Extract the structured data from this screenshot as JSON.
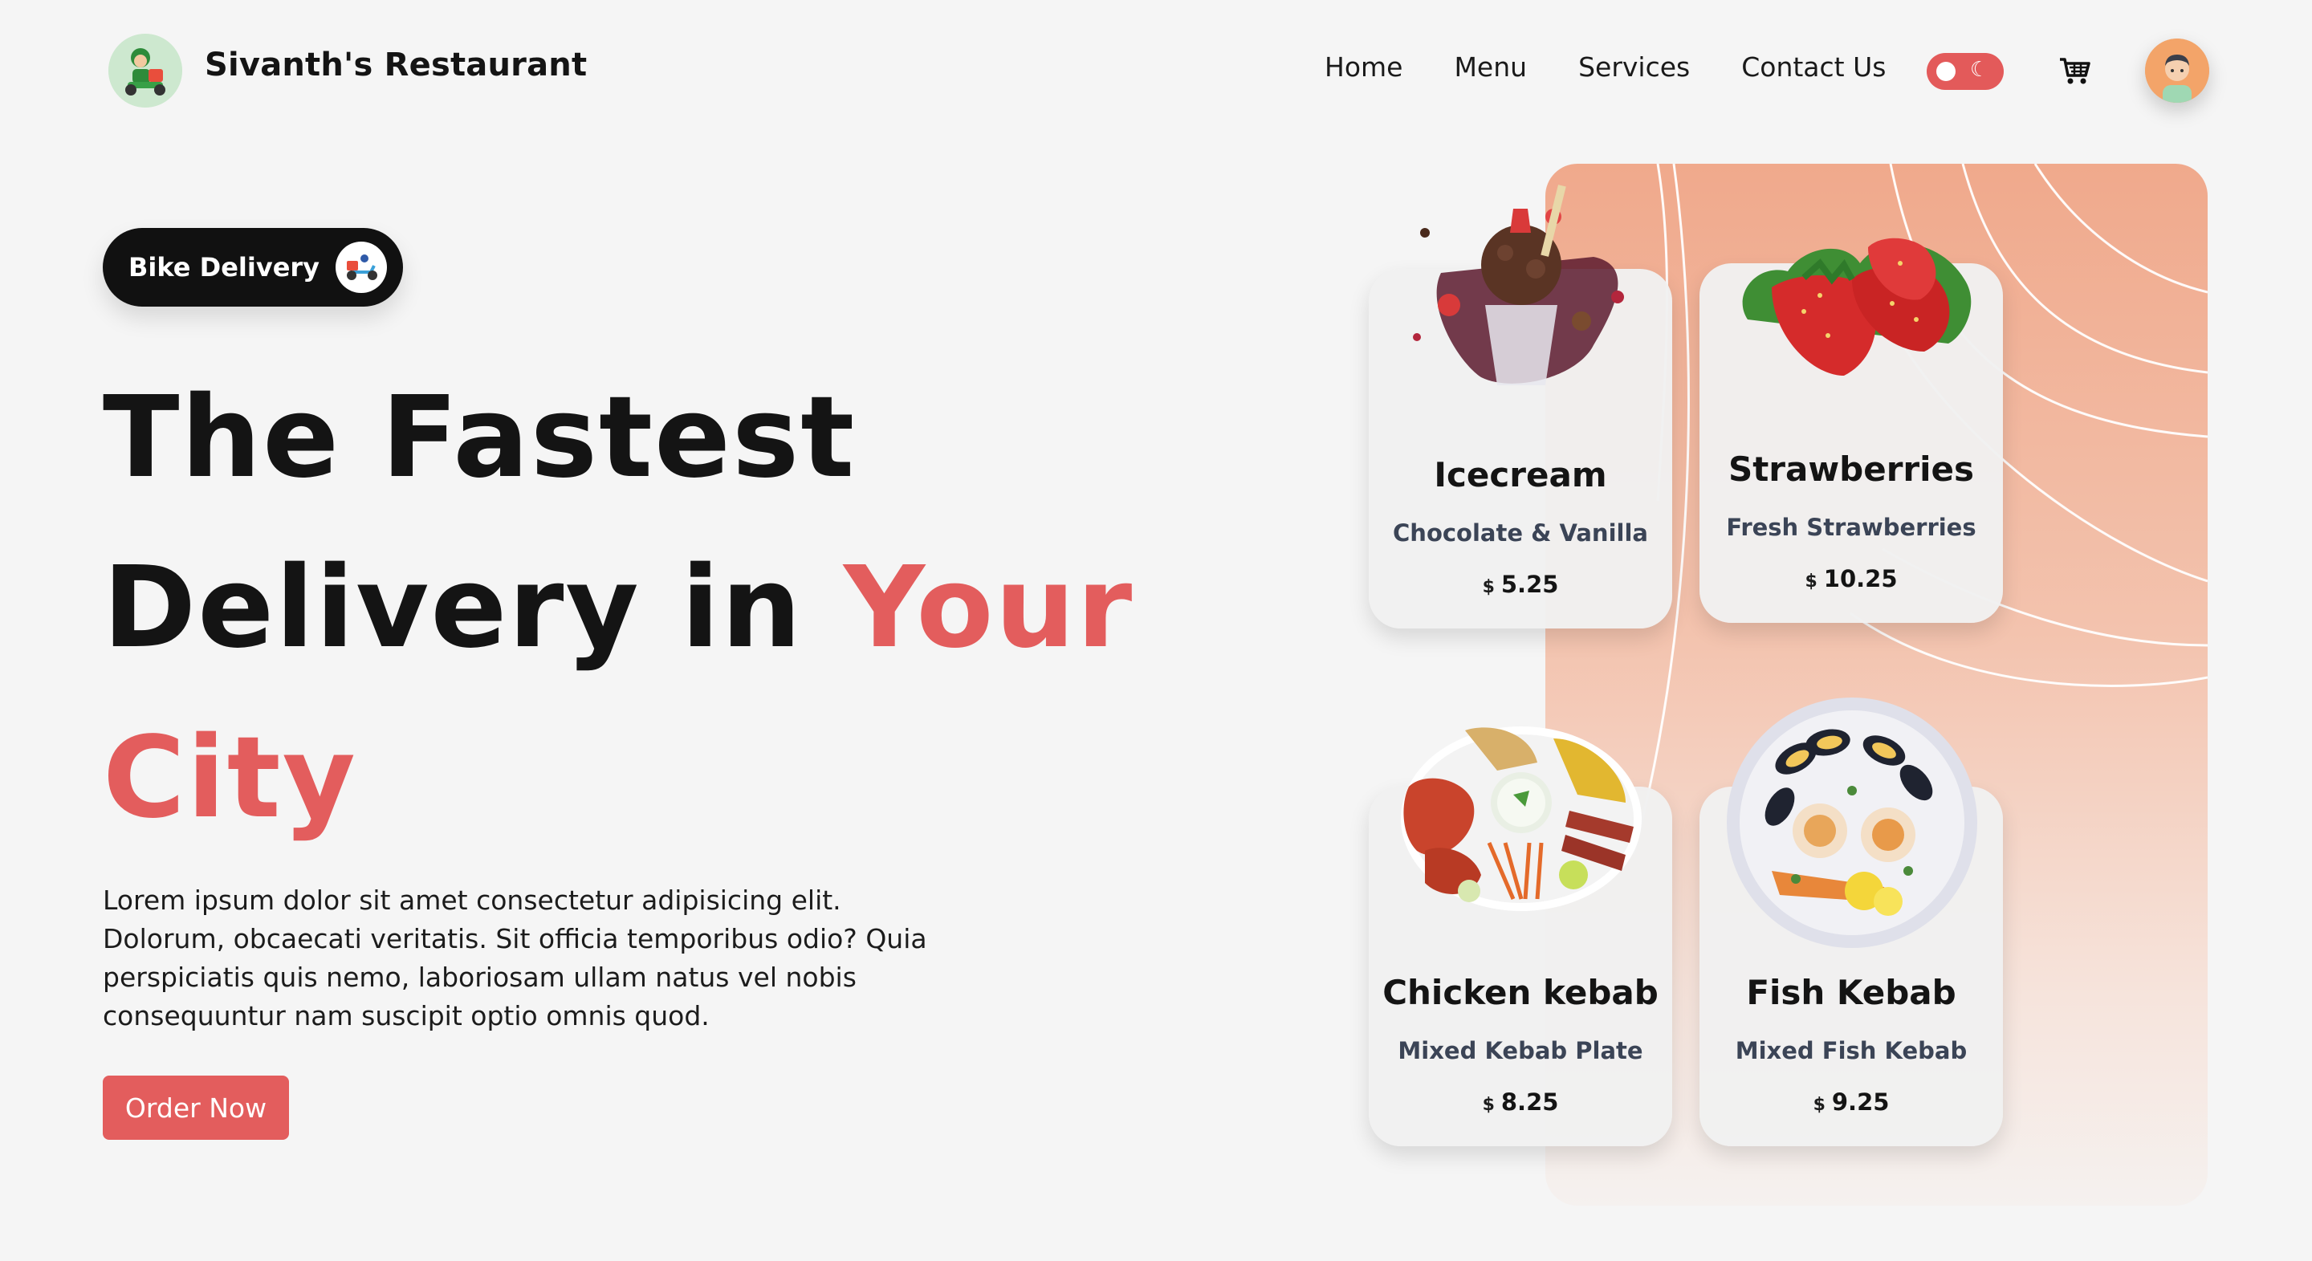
{
  "header": {
    "brand": "Sivanth's Restaurant",
    "nav": [
      "Home",
      "Menu",
      "Services",
      "Contact Us"
    ],
    "theme_toggle_icon": "moon-icon",
    "cart_icon": "cart-icon"
  },
  "hero": {
    "badge": "Bike Delivery",
    "title_line1": "The Fastest",
    "title_line2_plain": "Delivery in ",
    "title_line2_accent": "Your",
    "title_line3_accent": "City",
    "description": "Lorem ipsum dolor sit amet consectetur adipisicing elit. Dolorum, obcaecati veritatis. Sit officia temporibus odio? Quia perspiciatis quis nemo, laboriosam ullam natus vel nobis consequuntur nam suscipit optio omnis quod.",
    "cta": "Order Now"
  },
  "menu_cards": [
    {
      "name": "Icecream",
      "desc": "Chocolate & Vanilla",
      "currency": "$",
      "price": "5.25"
    },
    {
      "name": "Strawberries",
      "desc": "Fresh Strawberries",
      "currency": "$",
      "price": "10.25"
    },
    {
      "name": "Chicken kebab",
      "desc": "Mixed Kebab Plate",
      "currency": "$",
      "price": "8.25"
    },
    {
      "name": "Fish Kebab",
      "desc": "Mixed Fish Kebab",
      "currency": "$",
      "price": "9.25"
    }
  ],
  "colors": {
    "accent": "#e35d5d",
    "background": "#f5f5f5",
    "panel_top": "#f0a98c",
    "badge_bg": "#111111"
  }
}
